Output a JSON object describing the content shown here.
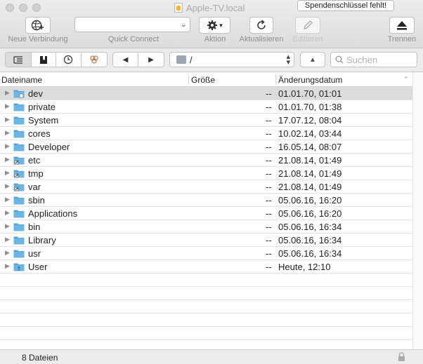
{
  "window": {
    "title": "Apple-TV.local",
    "donation_badge": "Spendenschlüssel fehlt!"
  },
  "toolbar": {
    "new_connection_label": "Neue Verbindung",
    "quick_connect_label": "Quick Connect",
    "quick_connect_value": "",
    "action_label": "Aktion",
    "refresh_label": "Aktualisieren",
    "edit_label": "Editieren",
    "disconnect_label": "Trennen"
  },
  "navbar": {
    "path": "/",
    "search_placeholder": "Suchen"
  },
  "columns": {
    "name": "Dateiname",
    "size": "Größe",
    "modified": "Änderungsdatum"
  },
  "files": [
    {
      "name": "dev",
      "size": "--",
      "modified": "01.01.70, 01:01",
      "icon": "folder-link",
      "selected": true
    },
    {
      "name": "private",
      "size": "--",
      "modified": "01.01.70, 01:38",
      "icon": "folder"
    },
    {
      "name": "System",
      "size": "--",
      "modified": "17.07.12, 08:04",
      "icon": "folder"
    },
    {
      "name": "cores",
      "size": "--",
      "modified": "10.02.14, 03:44",
      "icon": "folder"
    },
    {
      "name": "Developer",
      "size": "--",
      "modified": "16.05.14, 08:07",
      "icon": "folder"
    },
    {
      "name": "etc",
      "size": "--",
      "modified": "21.08.14, 01:49",
      "icon": "folder-alias"
    },
    {
      "name": "tmp",
      "size": "--",
      "modified": "21.08.14, 01:49",
      "icon": "folder-alias"
    },
    {
      "name": "var",
      "size": "--",
      "modified": "21.08.14, 01:49",
      "icon": "folder-alias"
    },
    {
      "name": "sbin",
      "size": "--",
      "modified": "05.06.16, 16:20",
      "icon": "folder"
    },
    {
      "name": "Applications",
      "size": "--",
      "modified": "05.06.16, 16:20",
      "icon": "folder"
    },
    {
      "name": "bin",
      "size": "--",
      "modified": "05.06.16, 16:34",
      "icon": "folder"
    },
    {
      "name": "Library",
      "size": "--",
      "modified": "05.06.16, 16:34",
      "icon": "folder"
    },
    {
      "name": "usr",
      "size": "--",
      "modified": "05.06.16, 16:34",
      "icon": "folder"
    },
    {
      "name": "User",
      "size": "--",
      "modified": "Heute, 12:10",
      "icon": "folder-user"
    }
  ],
  "status": {
    "file_count": "8 Dateien"
  },
  "colors": {
    "folder": "#6cb6e6",
    "folder_tab": "#5aa3d6",
    "selected_row": "#dcdcdc"
  }
}
